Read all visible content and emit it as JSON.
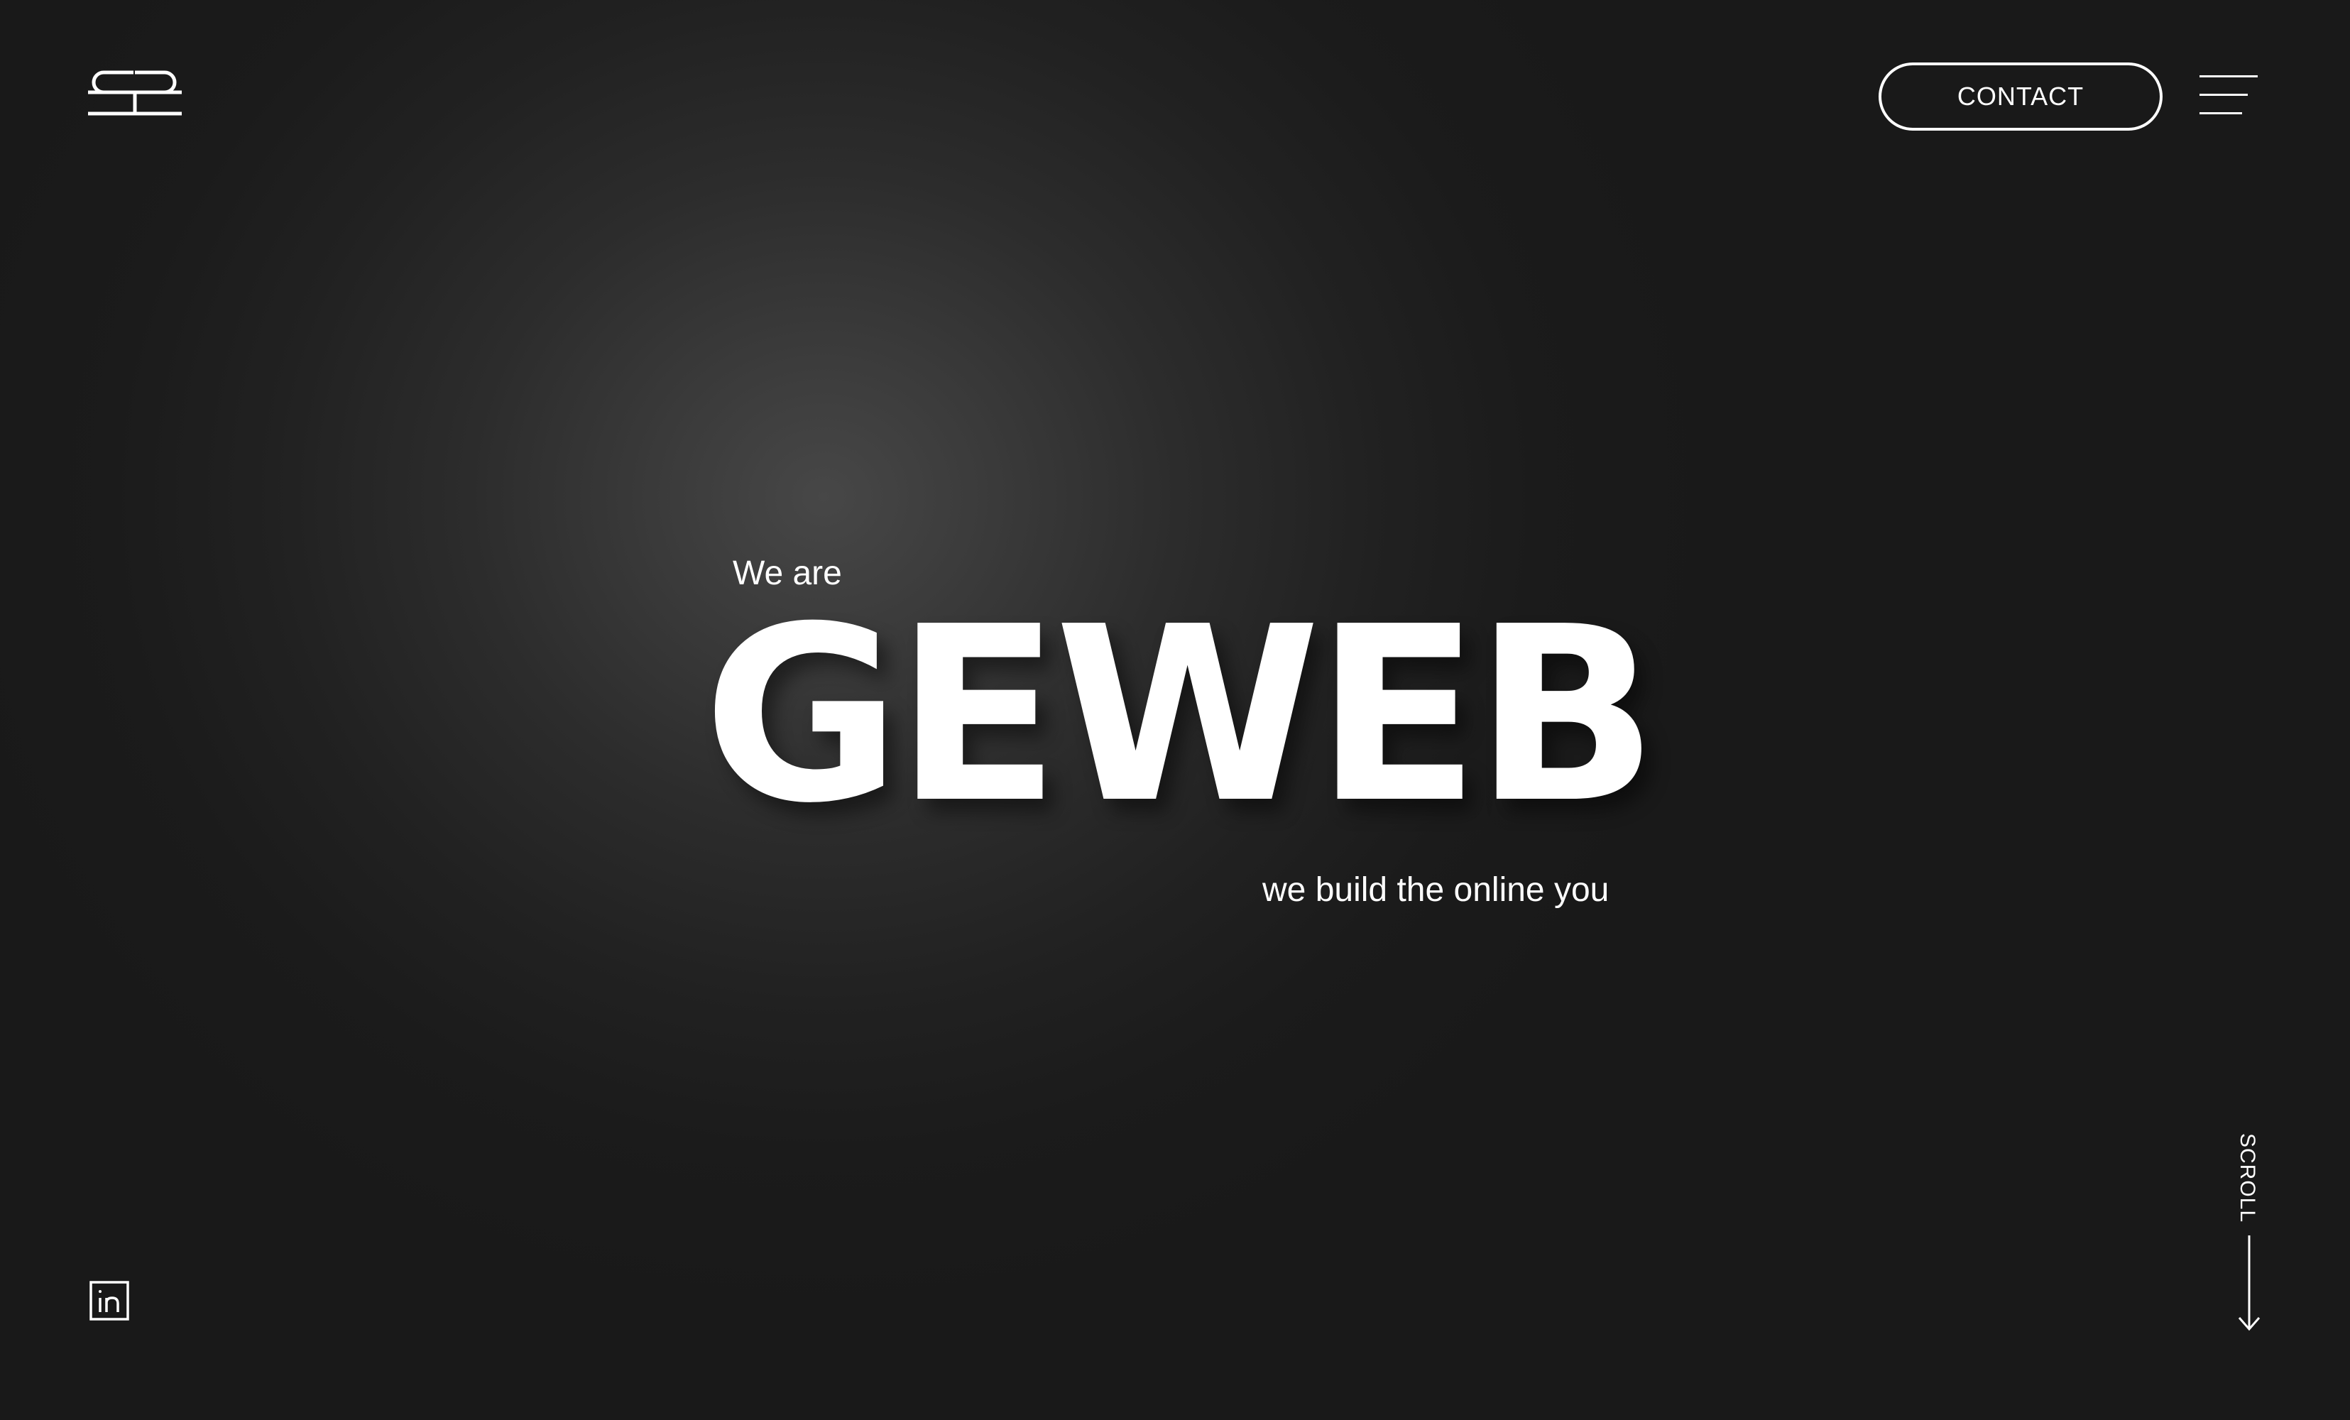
{
  "header": {
    "logo_icon": "geweb-logo-icon",
    "contact_label": "CONTACT",
    "menu_icon": "hamburger-menu-icon"
  },
  "hero": {
    "intro": "We are",
    "title": "GEWEB",
    "subtitle": "we build the online you"
  },
  "footer": {
    "social_icon": "linkedin-icon",
    "social_label": "in",
    "scroll_label": "SCROLL",
    "scroll_icon": "arrow-down-icon"
  },
  "colors": {
    "background": "#191919",
    "glow": "#474747",
    "foreground": "#ffffff"
  }
}
